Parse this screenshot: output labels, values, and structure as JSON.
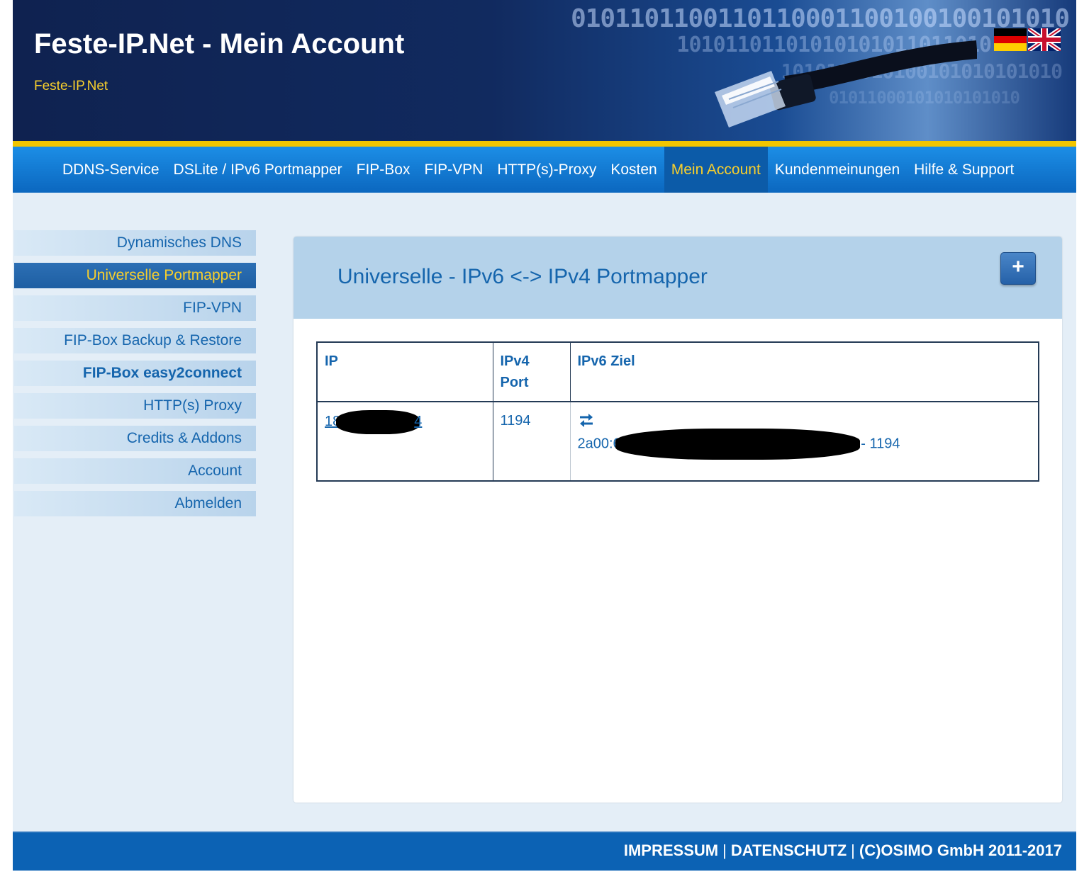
{
  "header": {
    "title": "Feste-IP.Net - Mein Account",
    "subtitle": "Feste-IP.Net",
    "binary_rows": [
      "0101101100110110001100100100101010",
      "10101101101010101011011010",
      "1010101010100101010101010",
      "01011000101010101010"
    ],
    "flags": [
      {
        "name": "german-flag-icon"
      },
      {
        "name": "uk-flag-icon"
      }
    ]
  },
  "nav": {
    "items": [
      {
        "label": "DDNS-Service",
        "active": false
      },
      {
        "label": "DSLite / IPv6 Portmapper",
        "active": false
      },
      {
        "label": "FIP-Box",
        "active": false
      },
      {
        "label": "FIP-VPN",
        "active": false
      },
      {
        "label": "HTTP(s)-Proxy",
        "active": false
      },
      {
        "label": "Kosten",
        "active": false
      },
      {
        "label": "Mein Account",
        "active": true
      },
      {
        "label": "Kundenmeinungen",
        "active": false
      },
      {
        "label": "Hilfe & Support",
        "active": false
      }
    ]
  },
  "sidebar": {
    "items": [
      {
        "label": "Dynamisches DNS",
        "active": false,
        "bold": false
      },
      {
        "label": "Universelle Portmapper",
        "active": true,
        "bold": false
      },
      {
        "label": "FIP-VPN",
        "active": false,
        "bold": false
      },
      {
        "label": "FIP-Box Backup & Restore",
        "active": false,
        "bold": false
      },
      {
        "label": "FIP-Box easy2connect",
        "active": false,
        "bold": true
      },
      {
        "label": "HTTP(s) Proxy",
        "active": false,
        "bold": false
      },
      {
        "label": "Credits & Addons",
        "active": false,
        "bold": false
      },
      {
        "label": "Account",
        "active": false,
        "bold": false
      },
      {
        "label": "Abmelden",
        "active": false,
        "bold": false
      }
    ]
  },
  "content": {
    "title": "Universelle - IPv6 <-> IPv4 Portmapper",
    "add_button_label": "+",
    "table": {
      "headers": {
        "ip": "IP",
        "ipv4_port_line1": "IPv4",
        "ipv4_port_line2": "Port",
        "ipv6_target": "IPv6 Ziel"
      },
      "rows": [
        {
          "ip_prefix": "18",
          "ip_suffix": "4",
          "port": "1194",
          "ipv6_prefix": "2a00:6",
          "ipv6_suffix": "- 1194"
        }
      ]
    }
  },
  "footer": {
    "impressum": "IMPRESSUM",
    "datenschutz": "DATENSCHUTZ",
    "copyright": "(C)OSIMO GmbH 2011-2017",
    "separator": "|"
  },
  "colors": {
    "header_bg": "#0f2250",
    "nav_bg": "#0b67bf",
    "accent_yellow": "#f8cf2c",
    "link_blue": "#1565ad",
    "footer_bg": "#0c62b4"
  }
}
